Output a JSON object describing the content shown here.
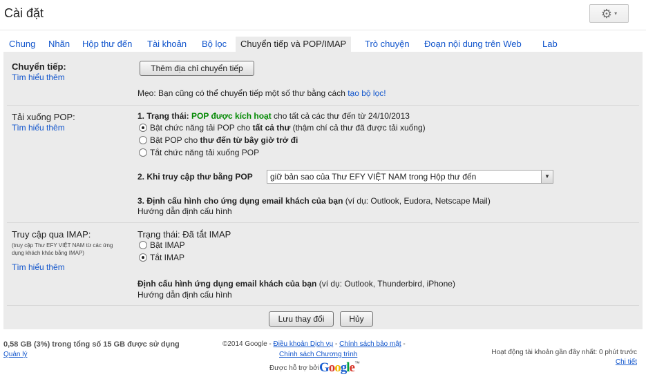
{
  "header": {
    "title": "Cài đặt",
    "gear_glyph": "⚙",
    "caret_glyph": "▾"
  },
  "tabs": [
    {
      "label": "Chung"
    },
    {
      "label": "Nhãn"
    },
    {
      "label": "Hộp thư đến"
    },
    {
      "label": "Tài khoản"
    },
    {
      "label": "Bộ lọc"
    },
    {
      "label": "Chuyển tiếp và POP/IMAP"
    },
    {
      "label": "Trò chuyện"
    },
    {
      "label": "Đoạn nội dung trên Web"
    },
    {
      "label": "Lab"
    }
  ],
  "forwarding": {
    "label": "Chuyển tiếp:",
    "learn_more": "Tìm hiểu thêm",
    "add_button": "Thêm địa chỉ chuyển tiếp",
    "tip_prefix": "Mẹo: Bạn cũng có thể chuyển tiếp một số thư bằng cách ",
    "tip_link": "tạo bộ lọc!"
  },
  "pop": {
    "label": "Tải xuống POP:",
    "learn_more": "Tìm hiểu thêm",
    "status_prefix": "1. Trạng thái: ",
    "status_value": "POP được kích hoạt",
    "status_suffix": " cho tất cả các thư đến từ 24/10/2013",
    "options": [
      {
        "pre": "Bật chức năng tải POP cho ",
        "bold": "tất cả thư",
        "post": " (thậm chí cả thư đã được tải xuống)",
        "selected": true
      },
      {
        "pre": "Bật POP cho ",
        "bold": "thư đến từ bây giờ trở đi",
        "post": "",
        "selected": false
      },
      {
        "pre": "Tắt chức năng tải xuống POP",
        "bold": "",
        "post": "",
        "selected": false
      }
    ],
    "access_label": "2. Khi truy cập thư bằng POP",
    "access_value": "giữ bản sao của Thư EFY VIỆT NAM trong Hộp thư đến",
    "config_label": "3. Định cấu hình cho ứng dụng email khách của bạn",
    "config_example": " (ví dụ: Outlook, Eudora, Netscape Mail)",
    "config_link": "Hướng dẫn định cấu hình"
  },
  "imap": {
    "label": "Truy cập qua IMAP:",
    "description": "(truy cập Thư EFY VIỆT NAM từ các ứng dụng khách khác bằng IMAP)",
    "learn_more": "Tìm hiểu thêm",
    "status": "Trạng thái: Đã tắt IMAP",
    "options": [
      {
        "label": "Bật IMAP",
        "selected": false
      },
      {
        "label": "Tắt IMAP",
        "selected": true
      }
    ],
    "config_label": "Định cấu hình ứng dụng email khách của bạn",
    "config_example": " (ví dụ: Outlook, Thunderbird, iPhone)",
    "config_link": "Hướng dẫn định cấu hình"
  },
  "actions": {
    "save": "Lưu thay đổi",
    "cancel": "Hủy"
  },
  "footer": {
    "storage": "0,58 GB (3%) trong tổng số 15 GB được sử dụng",
    "manage": "Quản lý",
    "copyright": "©2014 Google - ",
    "terms": "Điều khoản Dịch vụ",
    "sep1": " - ",
    "privacy": "Chính sách bảo mật",
    "sep2": " -",
    "program_policy": "Chính sách Chương trình",
    "powered_by": "Được hỗ trợ bởi ",
    "google": "Google",
    "tm": "™",
    "last_activity": "Hoạt động tài khoản gần đây nhất: 0 phút trước",
    "details": "Chi tiết"
  },
  "colors": {
    "link": "#1155cc",
    "panel": "#ebebeb",
    "status_green": "#008800"
  }
}
